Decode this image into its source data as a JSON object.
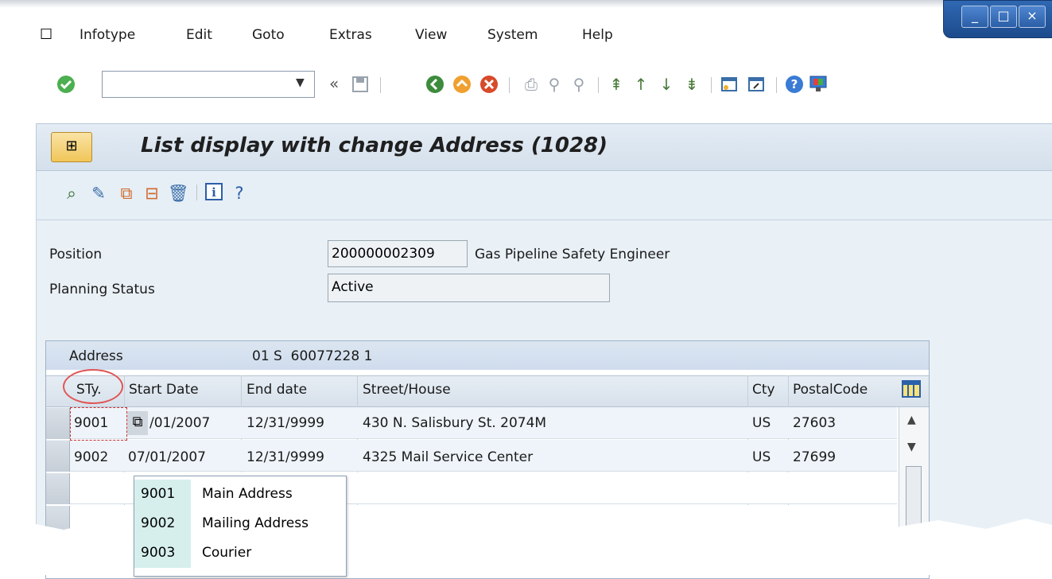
{
  "menu": {
    "items": [
      "Infotype",
      "Edit",
      "Goto",
      "Extras",
      "View",
      "System",
      "Help"
    ]
  },
  "window_controls": {
    "minimize": "_",
    "maximize": "□",
    "close": "×"
  },
  "toolbar": {
    "command_value": "",
    "prev_symbol": "«",
    "icons": [
      "enter-icon",
      "save-icon",
      "back-icon",
      "exit-icon",
      "cancel-icon",
      "print-icon",
      "find-icon",
      "find-next-icon",
      "first-page-icon",
      "prev-page-icon",
      "next-page-icon",
      "last-page-icon",
      "new-session-icon",
      "shortcut-icon",
      "help-icon",
      "customize-layout-icon"
    ]
  },
  "title": {
    "text": "List display with change Address (1028)"
  },
  "app_toolbar": {
    "icons": [
      "display-icon",
      "change-icon",
      "copy-icon",
      "delimit-icon",
      "delete-icon",
      "info-icon",
      "help-query-icon"
    ]
  },
  "form": {
    "position_label": "Position",
    "position_value": "200000002309",
    "position_text": "Gas Pipeline Safety Engineer",
    "planning_status_label": "Planning Status",
    "planning_status_value": "Active"
  },
  "table": {
    "header_label": "Address",
    "header_value": "01 S  60077228 1",
    "columns": [
      "STy.",
      "Start Date",
      "End date",
      "Street/House",
      "Cty",
      "PostalCode"
    ],
    "rows": [
      {
        "sty": "9001",
        "start": "07/01/2007",
        "start_visible": "/01/2007",
        "end": "12/31/9999",
        "street": "430 N. Salisbury St. 2074M",
        "cty": "US",
        "postal": "27603"
      },
      {
        "sty": "9002",
        "start": "07/01/2007",
        "end": "12/31/9999",
        "street": "4325 Mail Service Center",
        "cty": "US",
        "postal": "27699"
      }
    ]
  },
  "popup": {
    "items": [
      {
        "key": "9001",
        "value": "Main Address"
      },
      {
        "key": "9002",
        "value": "Mailing Address"
      },
      {
        "key": "9003",
        "value": "Courier"
      }
    ]
  },
  "colors": {
    "accent": "#2b5fa8",
    "highlight": "#e05555",
    "popup_key_bg": "#d6efed"
  }
}
